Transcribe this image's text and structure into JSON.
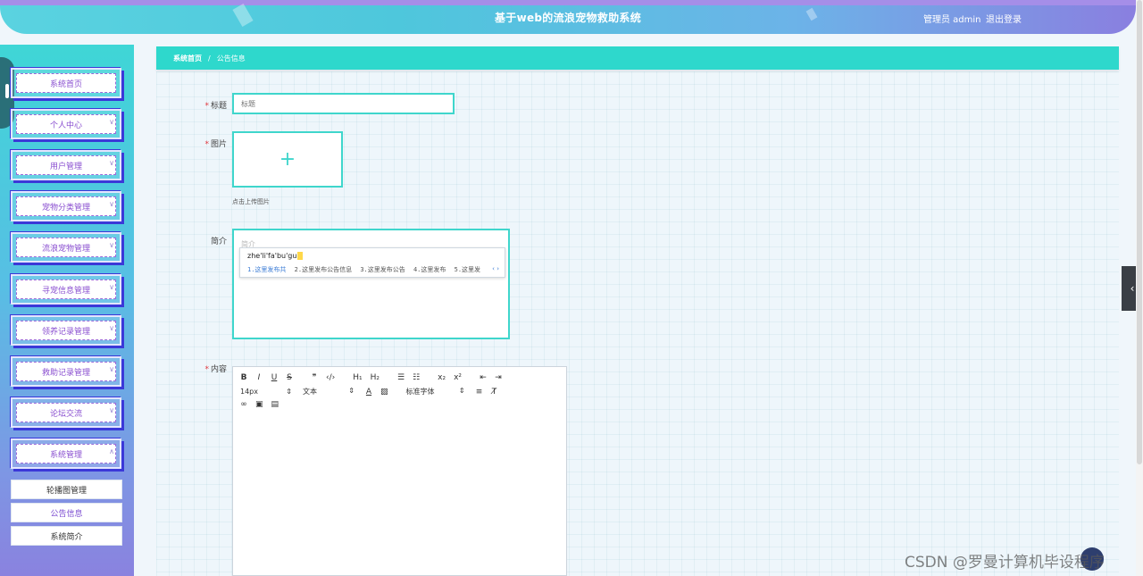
{
  "header": {
    "title": "基于web的流浪宠物救助系统",
    "user": "管理员 admin",
    "logout": "退出登录"
  },
  "sidebar": {
    "items": [
      {
        "label": "系统首页",
        "has_arrow": false
      },
      {
        "label": "个人中心",
        "has_arrow": true
      },
      {
        "label": "用户管理",
        "has_arrow": true
      },
      {
        "label": "宠物分类管理",
        "has_arrow": true
      },
      {
        "label": "流浪宠物管理",
        "has_arrow": true
      },
      {
        "label": "寻宠信息管理",
        "has_arrow": true
      },
      {
        "label": "领养记录管理",
        "has_arrow": true
      },
      {
        "label": "救助记录管理",
        "has_arrow": true
      },
      {
        "label": "论坛交流",
        "has_arrow": true
      },
      {
        "label": "系统管理",
        "has_arrow": true
      }
    ],
    "subitems": [
      {
        "label": "轮播图管理"
      },
      {
        "label": "公告信息"
      },
      {
        "label": "系统简介"
      }
    ]
  },
  "breadcrumb": {
    "home": "系统首页",
    "separator": "/",
    "current": "公告信息"
  },
  "form": {
    "title_label": "标题",
    "title_placeholder": "标题",
    "image_label": "图片",
    "upload_hint": "点击上传图片",
    "intro_label": "简介",
    "intro_placeholder": "简介",
    "content_label": "内容"
  },
  "ime": {
    "composition": "zhe'li'fa'bu'gu",
    "candidates": [
      "1.这里发布共",
      "2.这里发布公告信息",
      "3.这里发布公告",
      "4.这里发布",
      "5.这里发"
    ],
    "arrows": "‹ ›"
  },
  "editor": {
    "font_size": "14px",
    "header": "文本",
    "font_family": "标准字体"
  },
  "watermark": "CSDN @罗曼计算机毕设程序"
}
